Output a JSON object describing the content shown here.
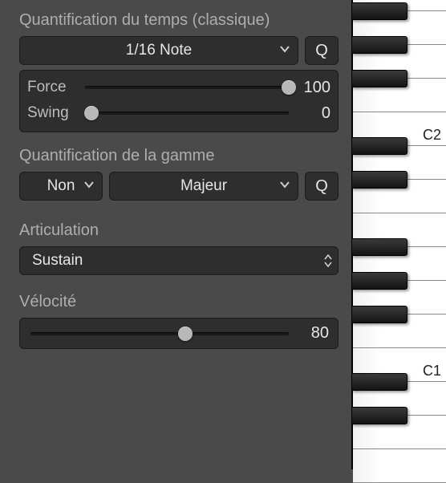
{
  "time_quantize": {
    "title": "Quantification du temps (classique)",
    "division": "1/16 Note",
    "q_label": "Q",
    "strength_label": "Force",
    "strength_value": "100",
    "strength_pct": 100,
    "swing_label": "Swing",
    "swing_value": "0",
    "swing_pct": 3
  },
  "scale_quantize": {
    "title": "Quantification de la gamme",
    "enable": "Non",
    "scale": "Majeur",
    "q_label": "Q"
  },
  "articulation": {
    "title": "Articulation",
    "value": "Sustain"
  },
  "velocity": {
    "title": "Vélocité",
    "value": "80",
    "pct": 60
  },
  "piano": {
    "label_c2": "C2",
    "label_c1": "C1"
  }
}
